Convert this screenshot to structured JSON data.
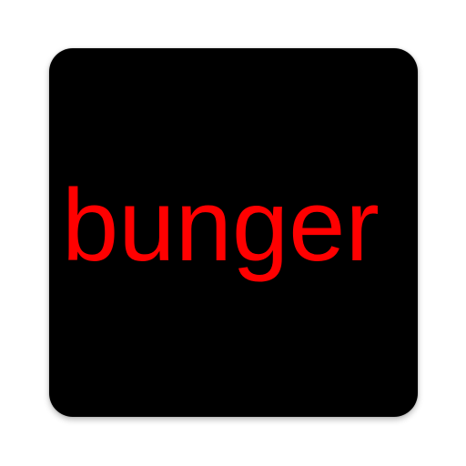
{
  "app_icon": {
    "label": "bunger",
    "background_color": "#000000",
    "text_color": "#ff0000"
  }
}
